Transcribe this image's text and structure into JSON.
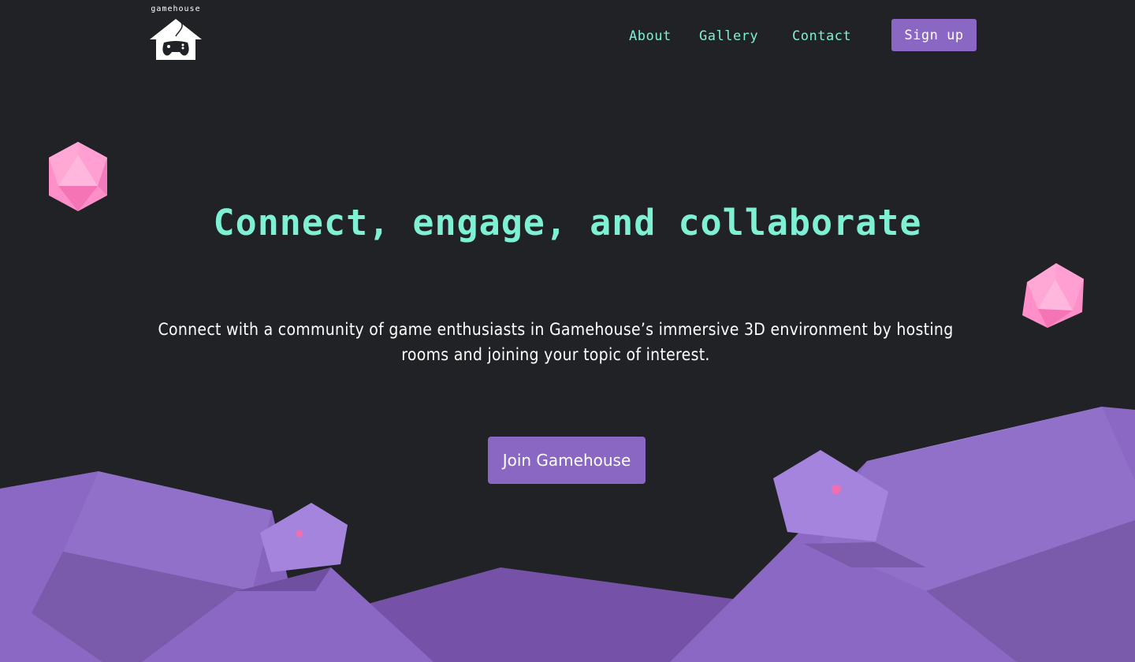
{
  "brand": {
    "logo_text": "gamehouse",
    "logo_icon": "house-gamepad-icon"
  },
  "nav": {
    "links": [
      "About",
      "Gallery",
      "Contact"
    ],
    "signup_label": "Sign up"
  },
  "hero": {
    "headline": "Connect, engage, and collaborate",
    "subtitle": "Connect with a community of game enthusiasts in Gamehouse’s immersive 3D environment by hosting rooms and joining your topic of interest.",
    "cta_label": "Join Gamehouse"
  },
  "decorations": [
    "d20-dice-icon",
    "d20-dice-icon",
    "polygon-creature",
    "polygon-creature"
  ],
  "colors": {
    "background": "#212226",
    "accent_text": "#7ef0d4",
    "button": "#8b67c4",
    "dice": "#ff8fc8",
    "mountains": "#8b67c4"
  }
}
